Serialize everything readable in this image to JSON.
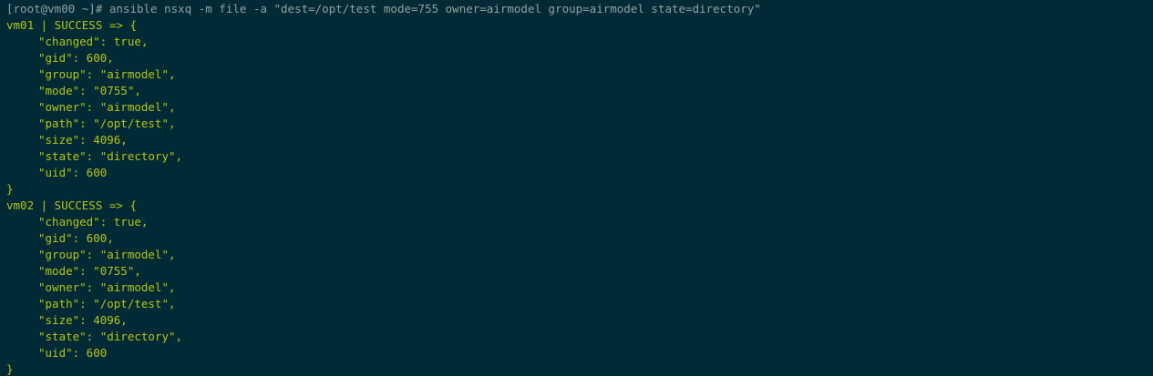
{
  "terminal": {
    "command_line": "[root@vm00 ~]# ansible nsxq -m file -a \"dest=/opt/test mode=755 owner=airmodel group=airmodel state=directory\"",
    "hosts": [
      {
        "header": "vm01 | SUCCESS => {",
        "fields": [
          "\"changed\": true,",
          "\"gid\": 600,",
          "\"group\": \"airmodel\",",
          "\"mode\": \"0755\",",
          "\"owner\": \"airmodel\",",
          "\"path\": \"/opt/test\",",
          "\"size\": 4096,",
          "\"state\": \"directory\",",
          "\"uid\": 600"
        ],
        "footer": "}"
      },
      {
        "header": "vm02 | SUCCESS => {",
        "fields": [
          "\"changed\": true,",
          "\"gid\": 600,",
          "\"group\": \"airmodel\",",
          "\"mode\": \"0755\",",
          "\"owner\": \"airmodel\",",
          "\"path\": \"/opt/test\",",
          "\"size\": 4096,",
          "\"state\": \"directory\",",
          "\"uid\": 600"
        ],
        "footer": "}"
      }
    ]
  },
  "colors": {
    "background": "#002b36",
    "prompt_text": "#93a1a1",
    "output_text": "#b9c40a"
  }
}
